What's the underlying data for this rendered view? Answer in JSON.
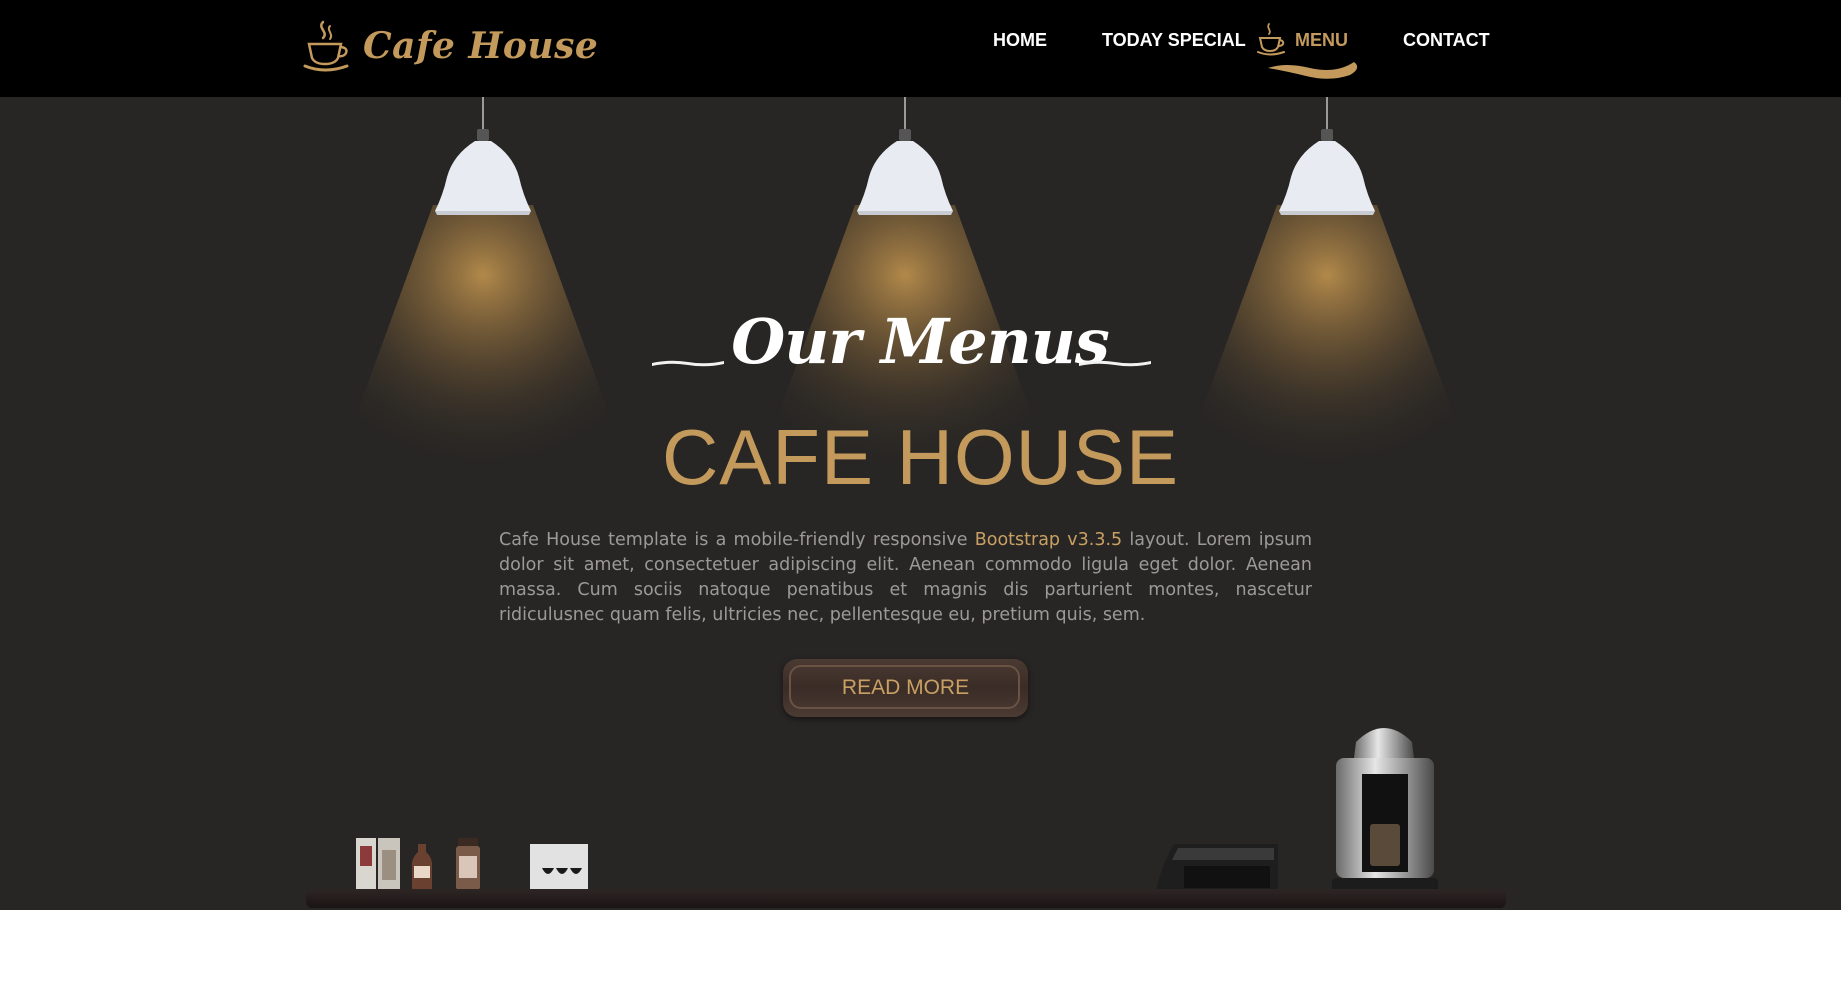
{
  "brand": {
    "name": "Cafe House"
  },
  "nav": {
    "items": [
      {
        "label": "HOME"
      },
      {
        "label": "TODAY SPECIAL"
      },
      {
        "label": "MENU"
      },
      {
        "label": "CONTACT"
      }
    ],
    "active": "MENU"
  },
  "hero": {
    "script_title": "Our Menus",
    "main_title": "CAFE HOUSE",
    "description_before": "Cafe House template is a mobile-friendly responsive ",
    "description_highlight": "Bootstrap v3.3.5",
    "description_after": " layout. Lorem ipsum dolor sit amet, consectetuer adipiscing elit. Aenean commodo ligula eget dolor. Aenean massa. Cum sociis natoque penatibus et magnis dis parturient montes, nascetur ridiculusnec quam felis, ultricies nec, pellentesque eu, pretium quis, sem.",
    "button_label": "READ MORE"
  },
  "colors": {
    "accent": "#c39a5c",
    "navbar_bg": "#000000",
    "hero_bg": "#282624",
    "text_muted": "#9c9a98"
  },
  "icons": [
    "coffee-cup-icon",
    "steam-icon",
    "lamp-icon"
  ]
}
